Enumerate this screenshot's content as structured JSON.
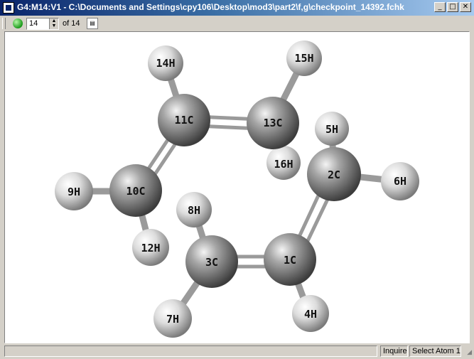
{
  "window": {
    "title": "G4:M14:V1 - C:\\Documents and Settings\\cpy106\\Desktop\\mod3\\part2\\f,g\\checkpoint_14392.fchk",
    "minimize": "_",
    "maximize": "□",
    "close": "✕"
  },
  "toolbar": {
    "frame_value": "14",
    "of_label": "of",
    "total_frames": "14"
  },
  "molecule": {
    "atoms": [
      {
        "label": "14H"
      },
      {
        "label": "15H"
      },
      {
        "label": "11C"
      },
      {
        "label": "13C"
      },
      {
        "label": "5H"
      },
      {
        "label": "16H"
      },
      {
        "label": "2C"
      },
      {
        "label": "9H"
      },
      {
        "label": "10C"
      },
      {
        "label": "6H"
      },
      {
        "label": "8H"
      },
      {
        "label": "12H"
      },
      {
        "label": "3C"
      },
      {
        "label": "1C"
      },
      {
        "label": "7H"
      },
      {
        "label": "4H"
      }
    ]
  },
  "status": {
    "mode": "Inquire",
    "message": "Select Atom 1"
  }
}
